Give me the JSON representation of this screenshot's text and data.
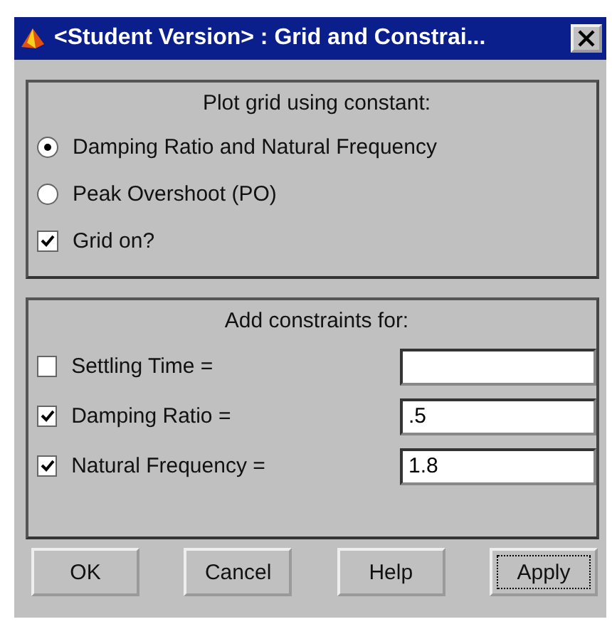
{
  "window": {
    "title": "<Student Version> : Grid and Constrai..."
  },
  "grid_panel": {
    "heading": "Plot grid using constant:",
    "options": [
      {
        "label": "Damping Ratio and Natural Frequency",
        "selected": true
      },
      {
        "label": "Peak Overshoot (PO)",
        "selected": false
      }
    ],
    "grid_on": {
      "label": "Grid on?",
      "checked": true
    }
  },
  "constraints_panel": {
    "heading": "Add constraints for:",
    "rows": [
      {
        "label": "Settling Time =",
        "checked": false
      },
      {
        "label": "Damping Ratio =",
        "checked": true,
        "value": ".5"
      },
      {
        "label": "Natural Frequency =",
        "checked": true,
        "value": "1.8"
      }
    ]
  },
  "buttons": [
    {
      "label": "OK",
      "focused": false
    },
    {
      "label": "Cancel",
      "focused": false
    },
    {
      "label": "Help",
      "focused": false
    },
    {
      "label": "Apply",
      "focused": true
    }
  ]
}
